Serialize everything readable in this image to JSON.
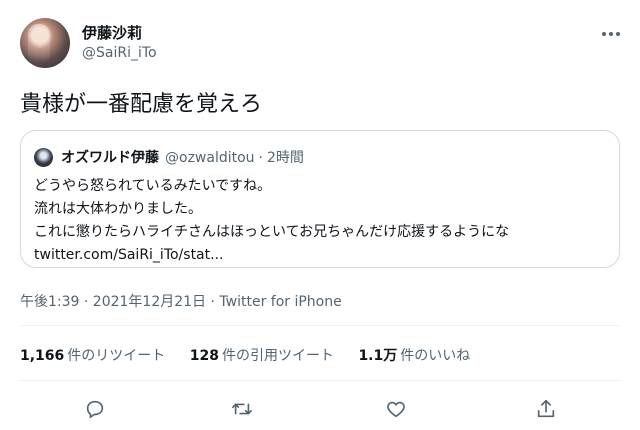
{
  "author": {
    "display_name": "伊藤沙莉",
    "handle": "@SaiRi_iTo"
  },
  "tweet": {
    "text": "貴様が一番配慮を覚えろ"
  },
  "quote": {
    "display_name": "オズワルド伊藤",
    "handle": "@ozwalditou",
    "separator": "·",
    "time": "2時間",
    "lines": [
      "どうやら怒られているみたいですね。",
      "流れは大体わかりました。",
      "これに懲りたらハライチさんはほっといてお兄ちゃんだけ応援するようにな",
      "twitter.com/SaiRi_iTo/stat..."
    ]
  },
  "meta": {
    "timestamp": "午後1:39 · 2021年12月21日 · Twitter for iPhone"
  },
  "stats": [
    {
      "value": "1,166",
      "label": "件のリツイート"
    },
    {
      "value": "128",
      "label": "件の引用ツイート"
    },
    {
      "value": "1.1万",
      "label": "件のいいね"
    }
  ],
  "actions": [
    "reply-icon",
    "retweet-icon",
    "like-icon",
    "share-icon"
  ],
  "colors": {
    "text": "#0f1419",
    "secondary": "#536471",
    "border": "#cfd9de"
  }
}
